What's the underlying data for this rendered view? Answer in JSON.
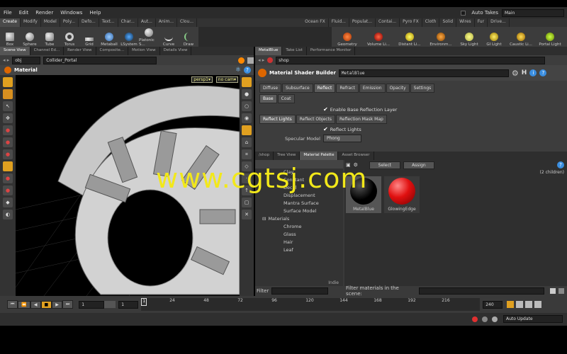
{
  "menu": [
    "File",
    "Edit",
    "Render",
    "Windows",
    "Help"
  ],
  "auto_takes": "Auto Takes",
  "desktop": "Main",
  "shelf_tabs_left": [
    "Create",
    "Modify",
    "Model",
    "Poly...",
    "Defo...",
    "Text...",
    "Char...",
    "Aut...",
    "Anim...",
    "Clou..."
  ],
  "shelf_tabs_right": [
    "Ocean FX",
    "Fluid...",
    "Populat...",
    "Contai...",
    "Pyro FX",
    "Cloth",
    "Solid",
    "Wires",
    "Fur",
    "Drive..."
  ],
  "tools_left": [
    "Box",
    "Sphere",
    "Tube",
    "Torus",
    "Grid",
    "Metaball",
    "LSystem",
    "Platonic S...",
    "Curve",
    "Draw"
  ],
  "tools_right": [
    "Geometry",
    "Volume Li...",
    "Distant Li...",
    "Environm...",
    "Sky Light",
    "GI Light",
    "Caustic Li...",
    "Portal Light"
  ],
  "left_pane": {
    "tabs": [
      "Scene View",
      "Channel Ed...",
      "Render View",
      "Composite...",
      "Motion View",
      "Details View"
    ],
    "path_obj": "obj",
    "path_node": "Collider_Portal",
    "title": "Material",
    "cam_persp": "persp1▾",
    "cam_nocam": "no cam▾"
  },
  "right_top": {
    "tabs": [
      "MetalBlue",
      "Take List",
      "Performance Monitor"
    ],
    "path": "shop",
    "builder_label": "Material Shader Builder",
    "builder_name": "MetalBlue",
    "param_tabs": [
      "Diffuse",
      "Subsurface",
      "Reflect",
      "Refract",
      "Emission",
      "Opacity",
      "Settings"
    ],
    "sub_tabs": [
      "Base",
      "Coat"
    ],
    "enable_base": "Enable Base Reflection Layer",
    "reflect_tabs": [
      "Reflect Lights",
      "Reflect Objects",
      "Reflection Mask Map"
    ],
    "reflect_lights": "Reflect Lights",
    "specular_label": "Specular Model",
    "specular_value": "Phong"
  },
  "right_bottom": {
    "tabs": [
      "/shop",
      "Tree View",
      "Material Palette",
      "Asset Browser"
    ],
    "select": "Select",
    "assign": "Assign",
    "count": "(2 children)",
    "tree": [
      "Clay",
      "Constant",
      "Decal",
      "Displacement",
      "Mantra Surface",
      "Surface Model"
    ],
    "materials_group": "Materials",
    "materials": [
      "Chrome",
      "Glass",
      "Hair",
      "Leaf"
    ],
    "indie": "Indie",
    "filter": "Filter",
    "filter_scene": "Filter materials in the scene:",
    "swatches": [
      {
        "name": "MetalBlue",
        "color": "#000000"
      },
      {
        "name": "GlowingEdge",
        "color": "#e01010"
      }
    ]
  },
  "timeline": {
    "frame": "1",
    "start": "1",
    "ticks": [
      "1",
      "24",
      "48",
      "72",
      "96",
      "120",
      "144",
      "168",
      "192",
      "216"
    ],
    "end": "240"
  },
  "status": {
    "auto_update": "Auto Update"
  },
  "watermark": "www.cgtsj.com"
}
